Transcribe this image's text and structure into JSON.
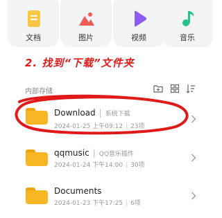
{
  "categories": [
    {
      "label": "文档",
      "icon": "document-icon",
      "color": "#f6c744"
    },
    {
      "label": "图片",
      "icon": "image-icon",
      "color": "#ef5a57"
    },
    {
      "label": "视频",
      "icon": "video-play-icon",
      "color": "#8c5cf0"
    },
    {
      "label": "音乐",
      "icon": "music-note-icon",
      "color": "#27c28a"
    }
  ],
  "annotation": "2. 找到“下载”文件夹",
  "storage": {
    "title": "内部存储",
    "toolbar_icons": [
      "new-folder-icon",
      "grid-view-icon",
      "sort-icon"
    ]
  },
  "files": [
    {
      "name": "Download",
      "desc": "系统下载",
      "date": "2024-01-25 上午09:12",
      "count": "23项"
    },
    {
      "name": "qqmusic",
      "desc": "QQ音乐插件",
      "date": "2024-01-24 下午14:00",
      "count": "30项"
    },
    {
      "name": "Documents",
      "desc": "",
      "date": "2024-01-23 下午17:25",
      "count": "6项"
    }
  ],
  "colors": {
    "annotation": "#e01919",
    "folder": "#f7b623"
  }
}
